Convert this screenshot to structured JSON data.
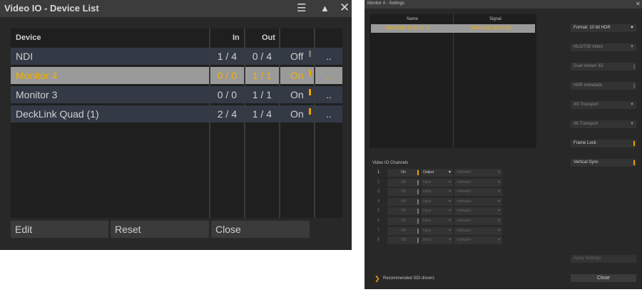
{
  "device_list": {
    "title": "Video IO - Device List",
    "icons": [
      "menu-icon",
      "collapse-icon",
      "close-icon"
    ],
    "columns": {
      "device": "Device",
      "in": "In",
      "out": "Out"
    },
    "rows": [
      {
        "device": "NDI",
        "in": "1 / 4",
        "out": "0 / 4",
        "status": "Off",
        "more": ".."
      },
      {
        "device": "Monitor 4",
        "in": "0 / 0",
        "out": "1 / 1",
        "status": "On",
        "more": ".."
      },
      {
        "device": "Monitor 3",
        "in": "0 / 0",
        "out": "1 / 1",
        "status": "On",
        "more": ".."
      },
      {
        "device": "DeckLink Quad (1)",
        "in": "2 / 4",
        "out": "1 / 4",
        "status": "On",
        "more": ".."
      }
    ],
    "selected_row": 1,
    "buttons": {
      "edit": "Edit",
      "reset": "Reset",
      "close": "Close"
    },
    "accent_color": "#f0b000"
  },
  "settings": {
    "title": "Monitor 4 - Settings",
    "columns": {
      "name": "Name",
      "signal": "Signal"
    },
    "signal_row": {
      "name": "3840x2160 @ 60.00 Hz",
      "signal": "3840x2160 @ 60.000"
    },
    "format": "Format: 10 bit HDR",
    "options": [
      "HLG/709 Video",
      "Dual stream 3D",
      "HDR metadata",
      "3G Transport",
      "4K Transport"
    ],
    "frame_lock": "Frame Lock",
    "vertical_sync": "Vertical Sync",
    "channels_label": "Video IO Channels",
    "channels": [
      {
        "num": "1",
        "state": "On",
        "mode": "Output",
        "route": "<default>"
      },
      {
        "num": "2",
        "state": "Off",
        "mode": "Input",
        "route": "<default>"
      },
      {
        "num": "3",
        "state": "Off",
        "mode": "Input",
        "route": "<default>"
      },
      {
        "num": "4",
        "state": "Off",
        "mode": "Input",
        "route": "<default>"
      },
      {
        "num": "5",
        "state": "Off",
        "mode": "Input",
        "route": "<default>"
      },
      {
        "num": "6",
        "state": "Off",
        "mode": "Input",
        "route": "<default>"
      },
      {
        "num": "7",
        "state": "Off",
        "mode": "Input",
        "route": "<default>"
      },
      {
        "num": "8",
        "state": "Off",
        "mode": "Input",
        "route": "<default>"
      }
    ],
    "recommended_link": "Recommended SDI drivers",
    "apply_button": "Apply Settings",
    "close_button": "Close"
  }
}
